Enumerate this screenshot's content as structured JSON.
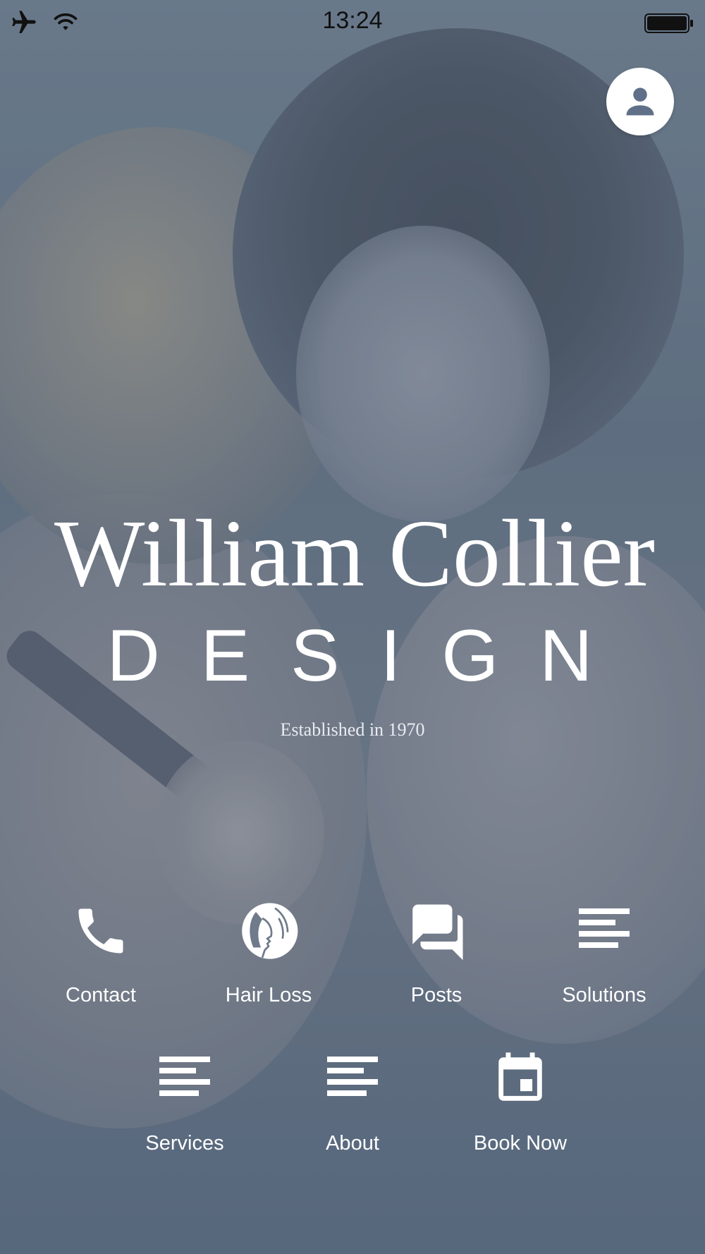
{
  "status_bar": {
    "time": "13:24",
    "icons": [
      "airplane-icon",
      "wifi-icon",
      "battery-icon"
    ]
  },
  "header": {
    "profile_icon": "person-icon"
  },
  "logo": {
    "brand": "William Collier",
    "sub": "DESIGN",
    "tagline": "Established in 1970"
  },
  "menu": {
    "row1": [
      {
        "label": "Contact",
        "icon": "phone-icon"
      },
      {
        "label": "Hair Loss",
        "icon": "woman-head-icon"
      },
      {
        "label": "Posts",
        "icon": "chat-bubbles-icon"
      },
      {
        "label": "Solutions",
        "icon": "text-lines-icon"
      }
    ],
    "row2": [
      {
        "label": "Services",
        "icon": "text-lines-icon"
      },
      {
        "label": "About",
        "icon": "text-lines-icon"
      },
      {
        "label": "Book Now",
        "icon": "calendar-icon"
      }
    ]
  },
  "colors": {
    "text": "#ffffff",
    "status_text": "#111111",
    "overlay": "#5c6e84"
  }
}
